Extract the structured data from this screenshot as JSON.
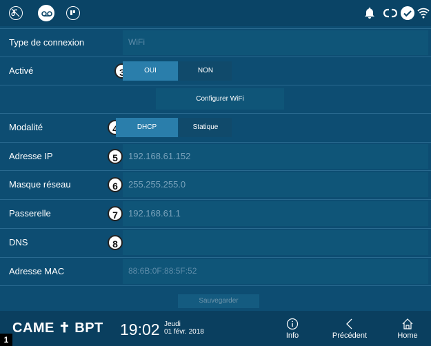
{
  "status_bar": {
    "left_icons": [
      "mute-icon",
      "voicemail-icon",
      "do-not-disturb-icon"
    ],
    "right_icons": [
      "bell-icon",
      "link-icon",
      "check-icon",
      "wifi-icon"
    ]
  },
  "rows": {
    "connection_type": {
      "label": "Type de connexion",
      "value": "WiFi"
    },
    "enabled": {
      "label": "Activé",
      "badge": "3",
      "options": [
        "OUI",
        "NON"
      ],
      "selected": "OUI"
    },
    "configure_wifi": {
      "label": "Configurer WiFi"
    },
    "mode": {
      "label": "Modalité",
      "badge": "4",
      "options": [
        "DHCP",
        "Statique"
      ],
      "selected": "DHCP"
    },
    "ip_address": {
      "label": "Adresse IP",
      "badge": "5",
      "value": "192.168.61.152"
    },
    "netmask": {
      "label": "Masque réseau",
      "badge": "6",
      "value": "255.255.255.0"
    },
    "gateway": {
      "label": "Passerelle",
      "badge": "7",
      "value": "192.168.61.1"
    },
    "dns": {
      "label": "DNS",
      "badge": "8",
      "value": ""
    },
    "mac_address": {
      "label": "Adresse MAC",
      "value": "88:6B:0F:88:5F:52"
    }
  },
  "save_button": {
    "label": "Sauvegarder"
  },
  "bottom_bar": {
    "logo": "CAME ✝ BPT",
    "time": "19:02",
    "day": "Jeudi",
    "date": "01 févr. 2018",
    "nav": [
      {
        "label": "Info",
        "icon": "info-icon"
      },
      {
        "label": "Précédent",
        "icon": "back-icon"
      },
      {
        "label": "Home",
        "icon": "home-icon"
      }
    ]
  },
  "corner_marker": "1",
  "colors": {
    "background": "#0d4d72",
    "field": "#0f5578",
    "segment_active": "#2a7eab",
    "segment_inactive": "#104a6b",
    "bars": "#0a4466"
  }
}
